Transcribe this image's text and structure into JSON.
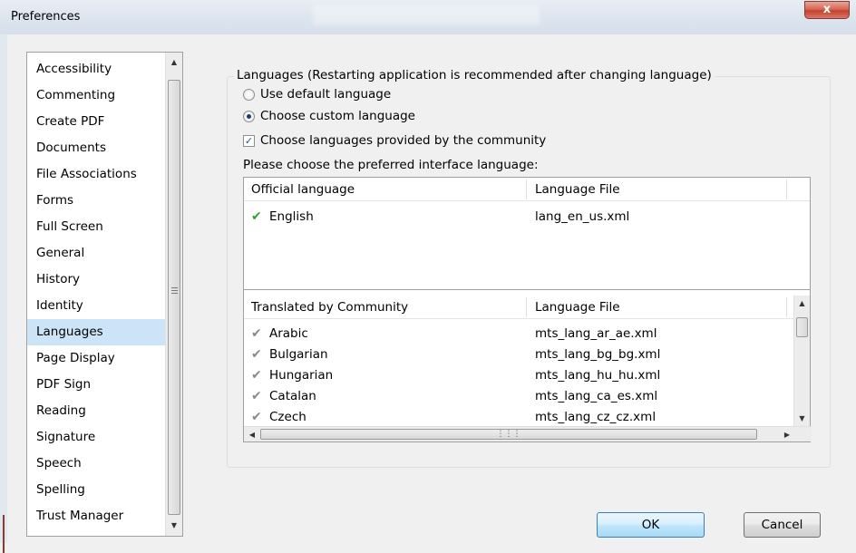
{
  "window": {
    "title": "Preferences",
    "close_label": "x"
  },
  "sidebar": {
    "items": [
      {
        "label": "Accessibility"
      },
      {
        "label": "Commenting"
      },
      {
        "label": "Create PDF"
      },
      {
        "label": "Documents"
      },
      {
        "label": "File Associations"
      },
      {
        "label": "Forms"
      },
      {
        "label": "Full Screen"
      },
      {
        "label": "General"
      },
      {
        "label": "History"
      },
      {
        "label": "Identity"
      },
      {
        "label": "Languages",
        "selected": true
      },
      {
        "label": "Page Display"
      },
      {
        "label": "PDF Sign"
      },
      {
        "label": "Reading"
      },
      {
        "label": "Signature"
      },
      {
        "label": "Speech"
      },
      {
        "label": "Spelling"
      },
      {
        "label": "Trust Manager"
      }
    ]
  },
  "languages": {
    "group_title": "Languages (Restarting application is recommended after changing language)",
    "use_default_label": "Use default language",
    "use_default_checked": false,
    "choose_custom_label": "Choose custom language",
    "choose_custom_checked": true,
    "community_label": "Choose languages provided by the community",
    "community_checked": true,
    "prompt": "Please choose the preferred interface language:",
    "official": {
      "headers": [
        "Official language",
        "Language File"
      ],
      "rows": [
        {
          "language": "English",
          "file": "lang_en_us.xml",
          "icon": "check-green-icon"
        }
      ]
    },
    "community": {
      "headers": [
        "Translated by Community",
        "Language File"
      ],
      "rows": [
        {
          "language": "Arabic",
          "file": "mts_lang_ar_ae.xml",
          "icon": "check-gray-icon"
        },
        {
          "language": "Bulgarian",
          "file": "mts_lang_bg_bg.xml",
          "icon": "check-gray-icon"
        },
        {
          "language": "Hungarian",
          "file": "mts_lang_hu_hu.xml",
          "icon": "check-gray-icon"
        },
        {
          "language": "Catalan",
          "file": "mts_lang_ca_es.xml",
          "icon": "check-gray-icon"
        },
        {
          "language": "Czech",
          "file": "mts_lang_cz_cz.xml",
          "icon": "check-gray-icon"
        }
      ]
    }
  },
  "buttons": {
    "ok": "OK",
    "cancel": "Cancel"
  },
  "colors": {
    "selection": "#cce4f7",
    "check_green": "#2fa12f",
    "ok_border": "#3c7fb1"
  }
}
